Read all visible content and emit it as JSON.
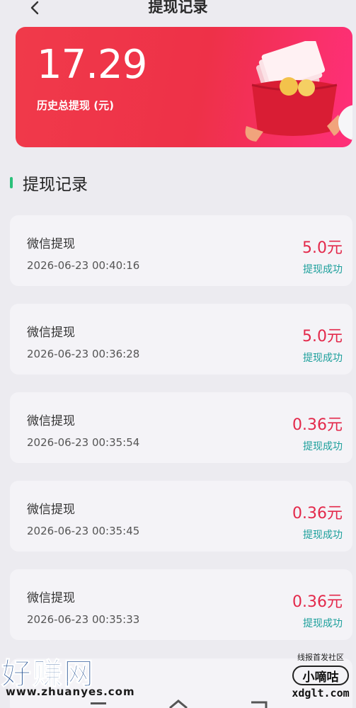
{
  "header": {
    "title": "提现记录",
    "back_icon": "chevron-left-icon"
  },
  "summary": {
    "amount": "17.29",
    "label": "历史总提现 (元)",
    "accent": "#ee3148"
  },
  "section": {
    "title": "提现记录",
    "bar_color": "#2bc07a"
  },
  "records": [
    {
      "title": "微信提现",
      "time": "2026-06-23 00:40:16",
      "amount": "5.0元",
      "status": "提现成功"
    },
    {
      "title": "微信提现",
      "time": "2026-06-23 00:36:28",
      "amount": "5.0元",
      "status": "提现成功"
    },
    {
      "title": "微信提现",
      "time": "2026-06-23 00:35:54",
      "amount": "0.36元",
      "status": "提现成功"
    },
    {
      "title": "微信提现",
      "time": "2026-06-23 00:35:45",
      "amount": "0.36元",
      "status": "提现成功"
    },
    {
      "title": "微信提现",
      "time": "2026-06-23 00:35:33",
      "amount": "0.36元",
      "status": "提现成功"
    }
  ],
  "colors": {
    "amount": "#e3294b",
    "status": "#1b9f9b"
  },
  "watermarks": {
    "left_big": "好赚网",
    "left_url": "www.zhuanyes.com",
    "right_small": "线报首发社区",
    "right_badge": "小嘀咕",
    "right_domain": "xdglt.com"
  }
}
